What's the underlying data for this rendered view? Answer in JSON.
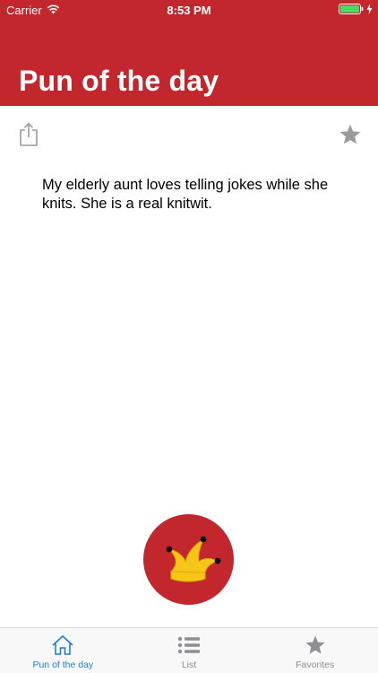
{
  "status_bar": {
    "carrier": "Carrier",
    "time": "8:53 PM",
    "battery_level": 1.0,
    "battery_color": "#4cd964"
  },
  "header": {
    "title": "Pun of the day",
    "background_color": "#c1272d"
  },
  "toolbar": {
    "share_icon": "share-icon",
    "favorite_icon": "star-icon",
    "icon_color": "#9b9b9b"
  },
  "pun": {
    "text": "My elderly aunt loves telling jokes while she knits. She is a real knitwit."
  },
  "action_button": {
    "icon": "jester-hat-icon",
    "background_color": "#c1272d",
    "icon_color": "#f5c518"
  },
  "tab_bar": {
    "active_color": "#1a7fd6",
    "inactive_color": "#8e8e93",
    "items": [
      {
        "label": "Pun of the day",
        "icon": "home-icon",
        "active": true
      },
      {
        "label": "List",
        "icon": "list-icon",
        "active": false
      },
      {
        "label": "Favorites",
        "icon": "star-icon",
        "active": false
      }
    ]
  }
}
